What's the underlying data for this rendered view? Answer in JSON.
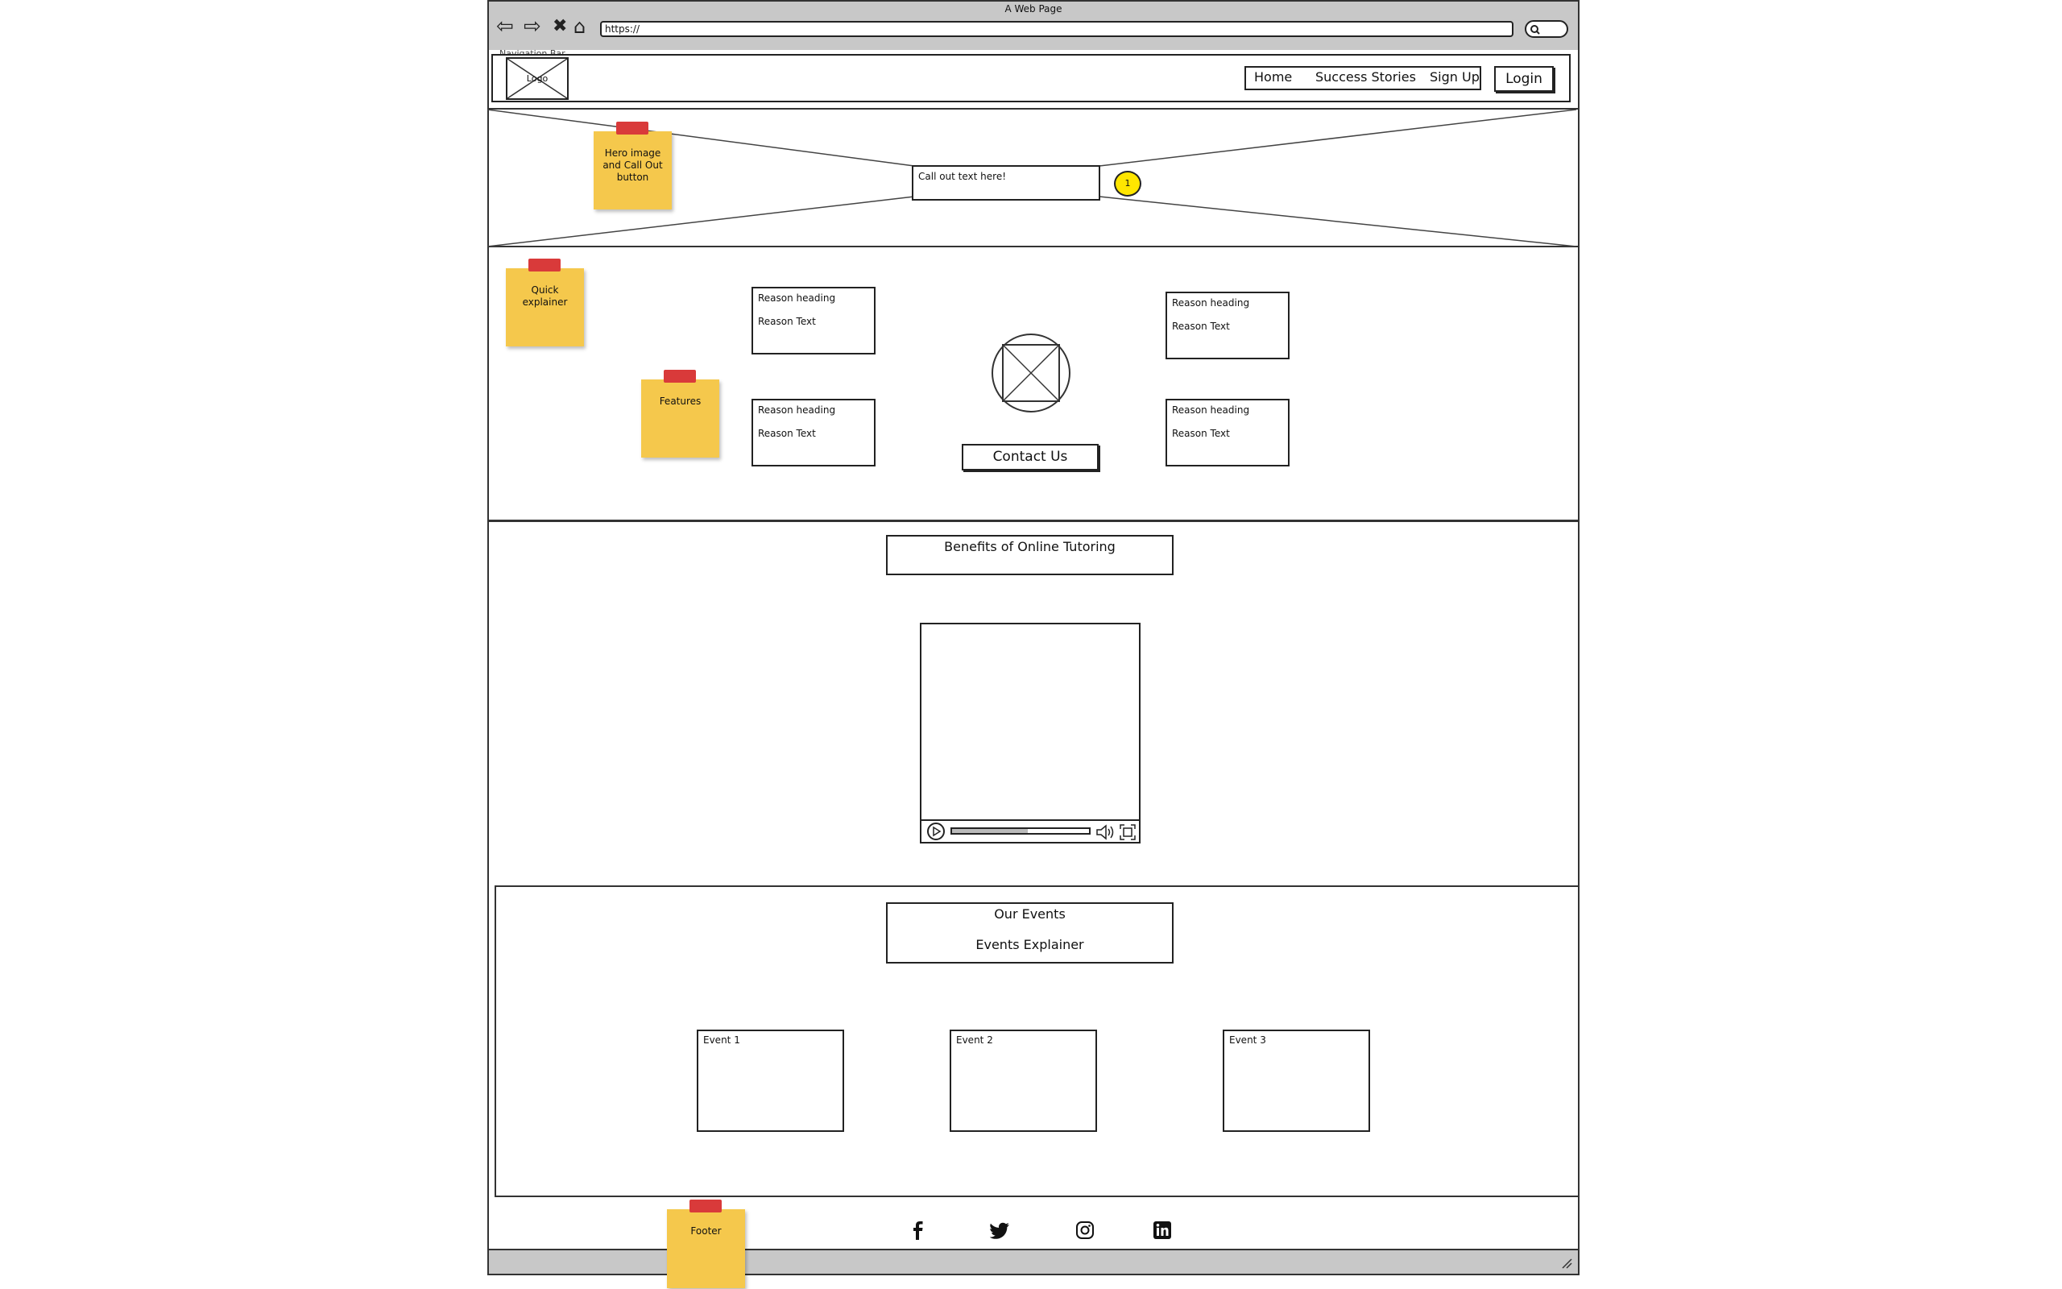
{
  "browser": {
    "title": "A Web Page",
    "url": "https://"
  },
  "navbar": {
    "label": "Navigation Bar",
    "logo": "Logo",
    "links": [
      "Home",
      "Success Stories",
      "Sign Up"
    ],
    "login": "Login"
  },
  "hero": {
    "callout": "Call out text here!",
    "badge": "1"
  },
  "reasons": [
    {
      "heading": "Reason heading",
      "text": "Reason Text"
    },
    {
      "heading": "Reason heading",
      "text": "Reason Text"
    },
    {
      "heading": "Reason heading",
      "text": "Reason Text"
    },
    {
      "heading": "Reason heading",
      "text": "Reason Text"
    }
  ],
  "contact_button": "Contact Us",
  "benefits": {
    "title": "Benefits of Online Tutoring"
  },
  "video": {
    "progress": 0.55
  },
  "events": {
    "title": "Our Events",
    "explainer": "Events Explainer",
    "items": [
      "Event 1",
      "Event 2",
      "Event 3"
    ]
  },
  "notes": {
    "hero": "Hero image and Call Out button",
    "quick": "Quick explainer",
    "features": "Features",
    "footer": "Footer"
  },
  "footer": {
    "icons": [
      "facebook-icon",
      "twitter-icon",
      "instagram-icon",
      "linkedin-icon"
    ]
  }
}
